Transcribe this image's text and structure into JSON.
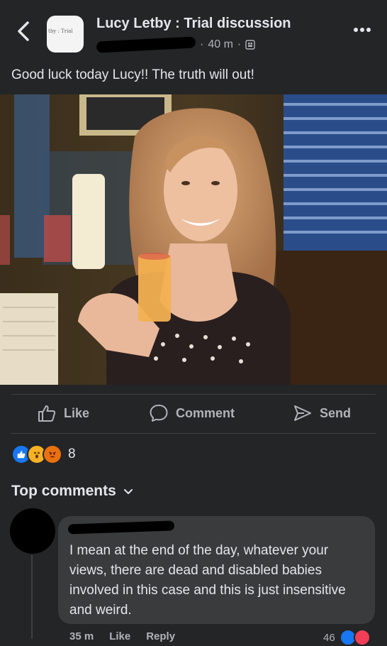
{
  "header": {
    "group_name": "Lucy Letby : Trial discussion",
    "time_ago": "40 m",
    "separator": "·",
    "avatar_text": "tby : Trial"
  },
  "post": {
    "text": "Good luck today Lucy!! The truth will out!"
  },
  "actions": {
    "like_label": "Like",
    "comment_label": "Comment",
    "send_label": "Send"
  },
  "reactions": {
    "count": "8",
    "icons": [
      "like-icon",
      "wow-icon",
      "angry-icon"
    ],
    "colors": {
      "like": "#1877f2",
      "wow": "#f7b125",
      "angry": "#e9710f"
    }
  },
  "comments_section": {
    "header": "Top comments"
  },
  "comment": {
    "text": "I mean at the end of the day, whatever your views, there are dead and disabled babies involved in this case and this is just insensitive and weird.",
    "time": "35 m",
    "like_label": "Like",
    "reply_label": "Reply",
    "reaction_count": "46"
  },
  "colors": {
    "background": "#242526",
    "bubble": "#3a3b3c",
    "text_primary": "#e4e6eb",
    "text_secondary": "#b0b3b8"
  }
}
